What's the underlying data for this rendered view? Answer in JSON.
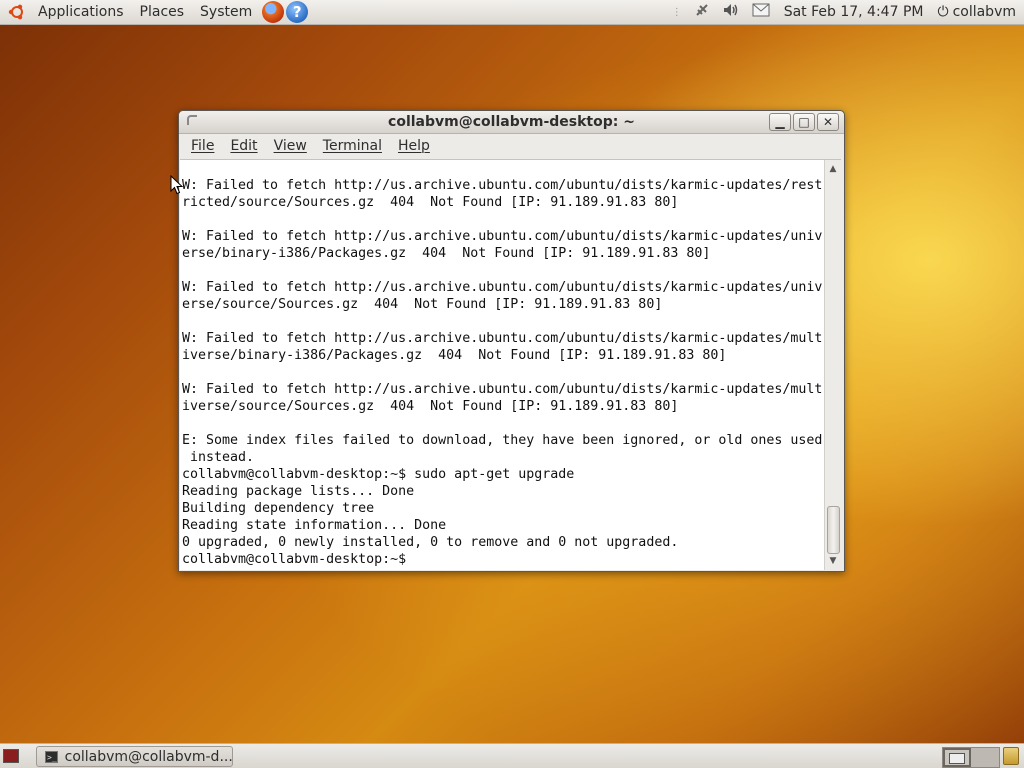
{
  "top_panel": {
    "menus": [
      "Applications",
      "Places",
      "System"
    ],
    "clock": "Sat Feb 17,  4:47 PM",
    "user": "collabvm"
  },
  "terminal": {
    "title": "collabvm@collabvm-desktop: ~",
    "menus": [
      "File",
      "Edit",
      "View",
      "Terminal",
      "Help"
    ],
    "output": "W: Failed to fetch http://us.archive.ubuntu.com/ubuntu/dists/karmic-updates/rest\nricted/source/Sources.gz  404  Not Found [IP: 91.189.91.83 80]\n\nW: Failed to fetch http://us.archive.ubuntu.com/ubuntu/dists/karmic-updates/univ\nerse/binary-i386/Packages.gz  404  Not Found [IP: 91.189.91.83 80]\n\nW: Failed to fetch http://us.archive.ubuntu.com/ubuntu/dists/karmic-updates/univ\nerse/source/Sources.gz  404  Not Found [IP: 91.189.91.83 80]\n\nW: Failed to fetch http://us.archive.ubuntu.com/ubuntu/dists/karmic-updates/mult\niverse/binary-i386/Packages.gz  404  Not Found [IP: 91.189.91.83 80]\n\nW: Failed to fetch http://us.archive.ubuntu.com/ubuntu/dists/karmic-updates/mult\niverse/source/Sources.gz  404  Not Found [IP: 91.189.91.83 80]\n\nE: Some index files failed to download, they have been ignored, or old ones used\n instead.\ncollabvm@collabvm-desktop:~$ sudo apt-get upgrade\nReading package lists... Done\nBuilding dependency tree\nReading state information... Done\n0 upgraded, 0 newly installed, 0 to remove and 0 not upgraded.\ncollabvm@collabvm-desktop:~$ "
  },
  "bottom_panel": {
    "task_label": "collabvm@collabvm-d..."
  },
  "icons": {
    "logo": "ubuntu-logo-icon",
    "browser": "firefox-icon",
    "help": "help-icon",
    "tray": [
      "network-icon",
      "volume-icon",
      "mail-icon"
    ],
    "power": "power-icon",
    "trash": "trash-icon"
  },
  "colors": {
    "panel": "#dcd8d2",
    "terminal_bg": "#ffffff",
    "wallpaper_accent": "#d58a12"
  }
}
